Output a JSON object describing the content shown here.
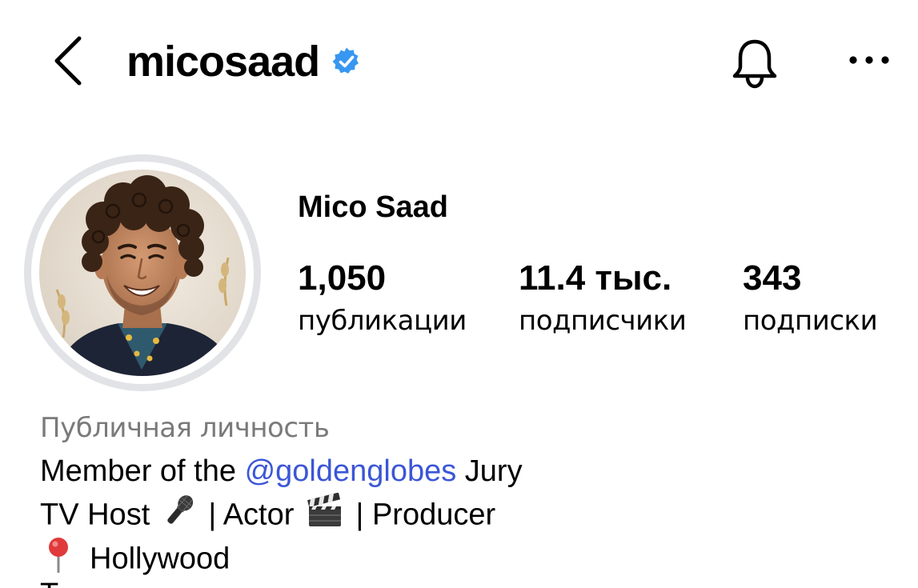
{
  "header": {
    "username": "micosaad",
    "back_icon": "chevron-left-icon",
    "verified_icon": "verified-badge-icon",
    "bell_icon": "bell-icon",
    "more_icon": "more-horizontal-icon"
  },
  "profile": {
    "display_name": "Mico Saad",
    "avatar_icon": "profile-photo"
  },
  "stats": [
    {
      "value": "1,050",
      "label": "публикации"
    },
    {
      "value": "11.4 тыс.",
      "label": "подписчики"
    },
    {
      "value": "343",
      "label": "подписки"
    }
  ],
  "bio": {
    "category": "Публичная личность",
    "line1_prefix": "Member of the ",
    "line1_mention": "@goldenglobes",
    "line1_suffix": " Jury",
    "line2_part1": "TV Host ",
    "line2_emoji1": "microphone-icon",
    "line2_part2": " | Actor ",
    "line2_emoji2": "clapper-board-icon",
    "line2_part3": " | Producer",
    "line3_emoji": "round-pushpin-icon",
    "line3_text": "Hollywood",
    "line4_partial": "T"
  },
  "colors": {
    "accent_mention": "#3b56d6",
    "verified_blue": "#3897f0",
    "category_gray": "#7a7a7a",
    "avatar_ring": "#e2e3e7"
  }
}
